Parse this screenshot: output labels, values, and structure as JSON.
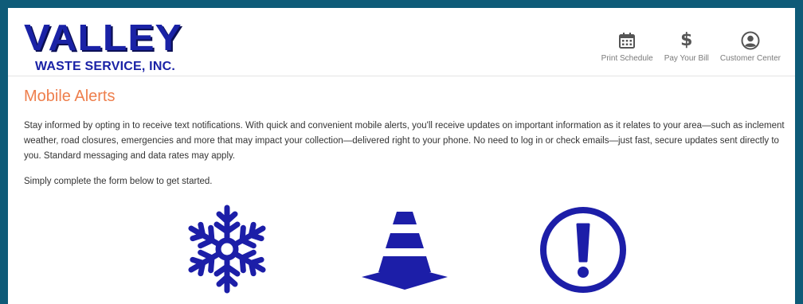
{
  "logo": {
    "main": "VALLEY",
    "sub": "WASTE SERVICE, INC."
  },
  "nav": {
    "items": [
      {
        "label": "Print Schedule",
        "icon": "calendar-icon"
      },
      {
        "label": "Pay Your Bill",
        "icon": "dollar-icon"
      },
      {
        "label": "Customer Center",
        "icon": "user-icon"
      }
    ]
  },
  "page": {
    "title": "Mobile Alerts",
    "intro": "Stay informed by opting in to receive text notifications. With quick and convenient mobile alerts, you'll receive updates on important information as it relates to your area—such as inclement weather, road closures, emergencies and more that may impact your collection—delivered right to your phone. No need to log in or check emails—just fast, secure updates sent directly to you. Standard messaging and data rates may apply.",
    "instruction": "Simply complete the form below to get started."
  },
  "alerts": {
    "icons": [
      "snowflake-icon",
      "traffic-cone-icon",
      "exclamation-icon"
    ]
  },
  "colors": {
    "frame": "#0e5b78",
    "brand_blue": "#1a22a6",
    "title_orange": "#ee7f4d",
    "icon_blue": "#1c1ea8"
  }
}
